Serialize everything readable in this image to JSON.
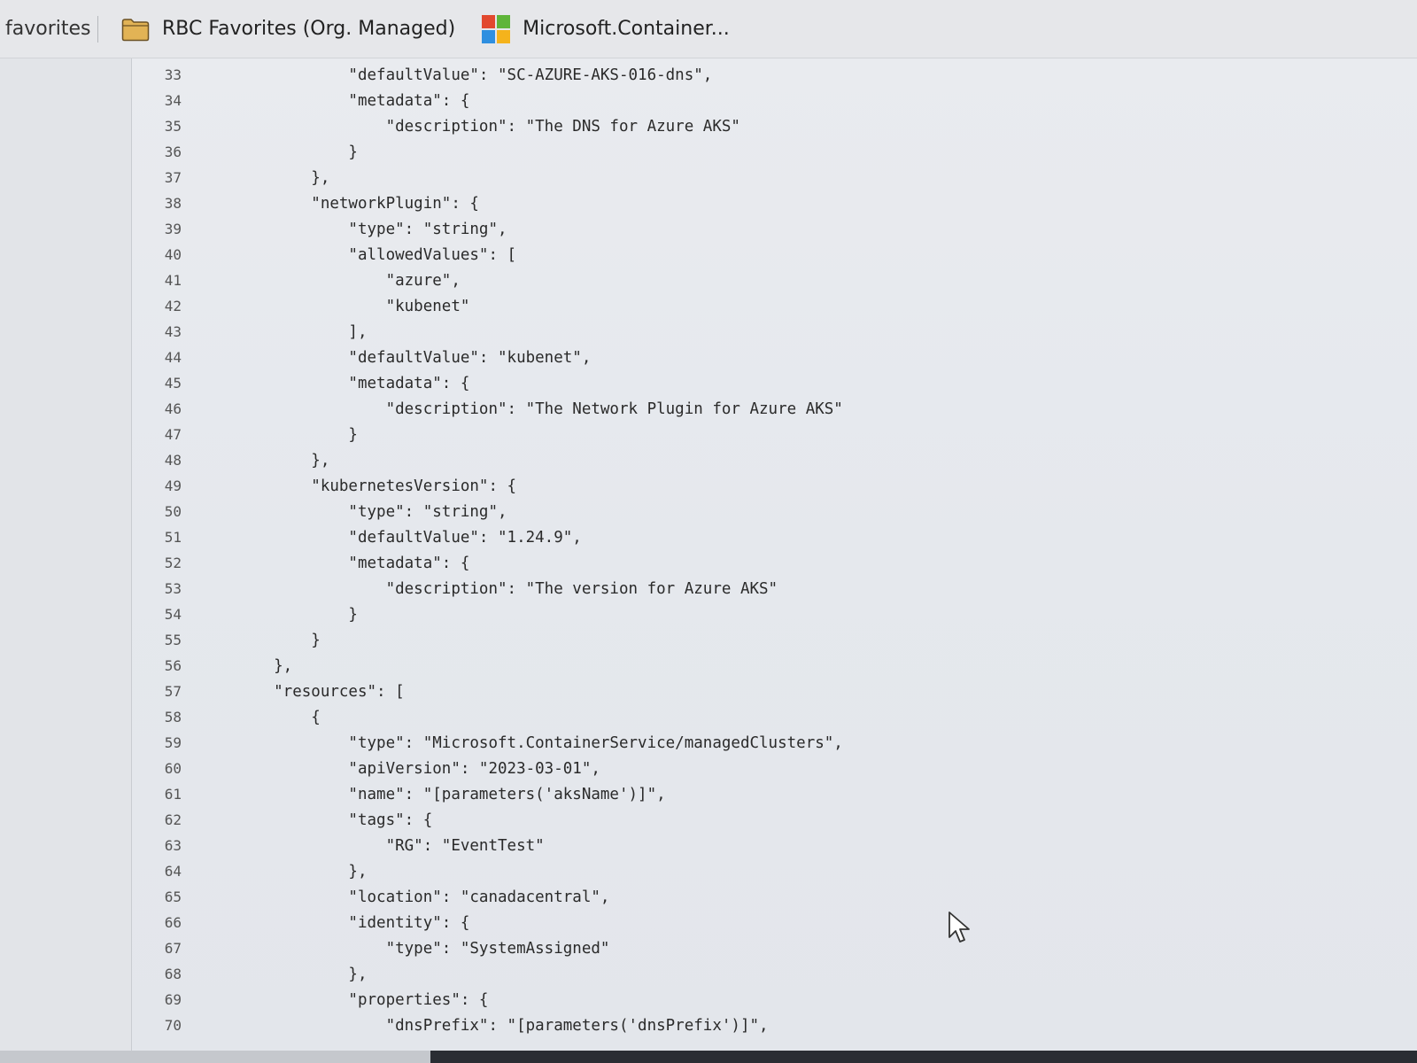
{
  "favorites_bar": {
    "label": "favorites",
    "items": [
      {
        "label": "RBC Favorites (Org. Managed)",
        "icon": "folder-icon"
      },
      {
        "label": "Microsoft.Container...",
        "icon": "microsoft-logo-icon"
      }
    ],
    "colors": {
      "folder": "#e2b355",
      "ms_red": "#e2492f",
      "ms_green": "#5fb53a",
      "ms_blue": "#2f8fe0",
      "ms_yellow": "#f5b31c"
    }
  },
  "code_view": {
    "lines": [
      {
        "num": "33",
        "text": "            \"defaultValue\": \"SC-AZURE-AKS-016-dns\","
      },
      {
        "num": "34",
        "text": "            \"metadata\": {"
      },
      {
        "num": "35",
        "text": "                \"description\": \"The DNS for Azure AKS\""
      },
      {
        "num": "36",
        "text": "            }"
      },
      {
        "num": "37",
        "text": "        },"
      },
      {
        "num": "38",
        "text": "        \"networkPlugin\": {"
      },
      {
        "num": "39",
        "text": "            \"type\": \"string\","
      },
      {
        "num": "40",
        "text": "            \"allowedValues\": ["
      },
      {
        "num": "41",
        "text": "                \"azure\","
      },
      {
        "num": "42",
        "text": "                \"kubenet\""
      },
      {
        "num": "43",
        "text": "            ],"
      },
      {
        "num": "44",
        "text": "            \"defaultValue\": \"kubenet\","
      },
      {
        "num": "45",
        "text": "            \"metadata\": {"
      },
      {
        "num": "46",
        "text": "                \"description\": \"The Network Plugin for Azure AKS\""
      },
      {
        "num": "47",
        "text": "            }"
      },
      {
        "num": "48",
        "text": "        },"
      },
      {
        "num": "49",
        "text": "        \"kubernetesVersion\": {"
      },
      {
        "num": "50",
        "text": "            \"type\": \"string\","
      },
      {
        "num": "51",
        "text": "            \"defaultValue\": \"1.24.9\","
      },
      {
        "num": "52",
        "text": "            \"metadata\": {"
      },
      {
        "num": "53",
        "text": "                \"description\": \"The version for Azure AKS\""
      },
      {
        "num": "54",
        "text": "            }"
      },
      {
        "num": "55",
        "text": "        }"
      },
      {
        "num": "56",
        "text": "    },"
      },
      {
        "num": "57",
        "text": "    \"resources\": ["
      },
      {
        "num": "58",
        "text": "        {"
      },
      {
        "num": "59",
        "text": "            \"type\": \"Microsoft.ContainerService/managedClusters\","
      },
      {
        "num": "60",
        "text": "            \"apiVersion\": \"2023-03-01\","
      },
      {
        "num": "61",
        "text": "            \"name\": \"[parameters('aksName')]\","
      },
      {
        "num": "62",
        "text": "            \"tags\": {"
      },
      {
        "num": "63",
        "text": "                \"RG\": \"EventTest\""
      },
      {
        "num": "64",
        "text": "            },"
      },
      {
        "num": "65",
        "text": "            \"location\": \"canadacentral\","
      },
      {
        "num": "66",
        "text": "            \"identity\": {"
      },
      {
        "num": "67",
        "text": "                \"type\": \"SystemAssigned\""
      },
      {
        "num": "68",
        "text": "            },"
      },
      {
        "num": "69",
        "text": "            \"properties\": {"
      },
      {
        "num": "70",
        "text": "                \"dnsPrefix\": \"[parameters('dnsPrefix')]\","
      }
    ]
  }
}
